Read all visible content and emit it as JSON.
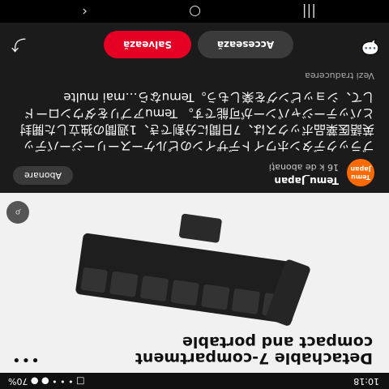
{
  "status_bar": {
    "time": "10:18",
    "battery": "70%",
    "signal": "□ • • • ● ●"
  },
  "pin": {
    "title": "Detachable 7-compartment compact and portable",
    "more_icon": "more-dots-icon",
    "visual_search_icon": "visual-search-icon"
  },
  "creator": {
    "avatar_text": "Temu Japan",
    "name": "Temu_Japan",
    "followers": "16 k de abonați",
    "follow_label": "Abonare"
  },
  "description": "ブラックデタンホワイトデザインのピルケースーリージーバデッ英語医薬品ボックスは、7日間に分割でき、1週間の独立した開封とバッテージャパンーが可能です。 Temuアプリをダウンロードして、ショッピングを楽しもう。Temuなら…mai multe",
  "translate_label": "Vezi traducerea",
  "actions": {
    "access_label": "Accesează",
    "save_label": "Salvează",
    "comment_icon": "comment-icon",
    "share_icon": "share-icon"
  },
  "navbar": {
    "recent_icon": "recent-apps-icon",
    "home_icon": "home-icon",
    "back_icon": "back-icon"
  }
}
